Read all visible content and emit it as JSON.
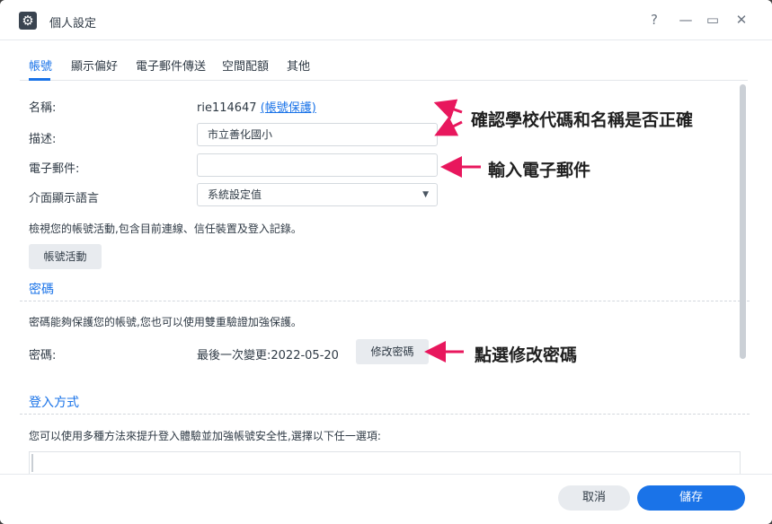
{
  "window": {
    "title": "個人設定",
    "icon": "gear-icon",
    "help_glyph": "?",
    "minimize_glyph": "—",
    "maximize_glyph": "▭",
    "close_glyph": "✕"
  },
  "tabs": [
    {
      "label": "帳號",
      "active": true
    },
    {
      "label": "顯示偏好",
      "active": false
    },
    {
      "label": "電子郵件傳送",
      "active": false
    },
    {
      "label": "空間配額",
      "active": false
    },
    {
      "label": "其他",
      "active": false
    }
  ],
  "account": {
    "name_label": "名稱:",
    "name_value": "rie114647",
    "name_link": "(帳號保護)",
    "description_label": "描述:",
    "description_value": "市立善化國小",
    "email_label": "電子郵件:",
    "email_value": "",
    "language_label": "介面顯示語言",
    "language_value": "系統設定值",
    "activity_desc": "檢視您的帳號活動,包含目前連線、信任裝置及登入記錄。",
    "activity_button": "帳號活動"
  },
  "password": {
    "section_title": "密碼",
    "desc": "密碼能夠保護您的帳號,您也可以使用雙重驗證加強保護。",
    "label": "密碼:",
    "last_changed": "最後一次變更:2022-05-20",
    "change_button": "修改密碼"
  },
  "login": {
    "section_title": "登入方式",
    "desc": "您可以使用多種方法來提升登入體驗並加強帳號安全性,選擇以下任一選項:"
  },
  "footer": {
    "cancel": "取消",
    "save": "儲存"
  },
  "annotations": [
    "確認學校代碼和名稱是否正確",
    "輸入電子郵件",
    "點選修改密碼"
  ],
  "colors": {
    "accent": "#1a73e8",
    "arrow": "#e8175d"
  }
}
